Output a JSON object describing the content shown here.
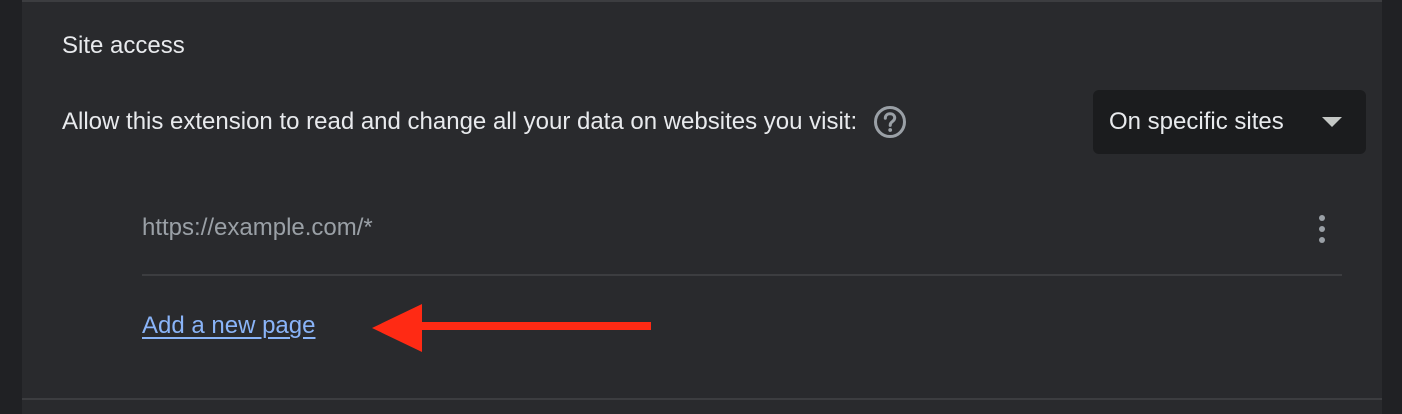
{
  "section": {
    "title": "Site access"
  },
  "access": {
    "label": "Allow this extension to read and change all your data on websites you visit:",
    "help_icon": "help-circle-icon",
    "select": {
      "value": "On specific sites",
      "caret_icon": "caret-down-icon"
    }
  },
  "sites": [
    {
      "url": "https://example.com/*",
      "menu_icon": "more-vertical-icon"
    }
  ],
  "add_page": {
    "label": "Add a new page"
  },
  "annotation": {
    "arrow_icon": "arrow-left-icon",
    "color": "#ff2a14"
  },
  "colors": {
    "background": "#202124",
    "card": "#292a2d",
    "text": "#e8eaed",
    "muted": "#9aa0a6",
    "link": "#8ab4f8"
  }
}
